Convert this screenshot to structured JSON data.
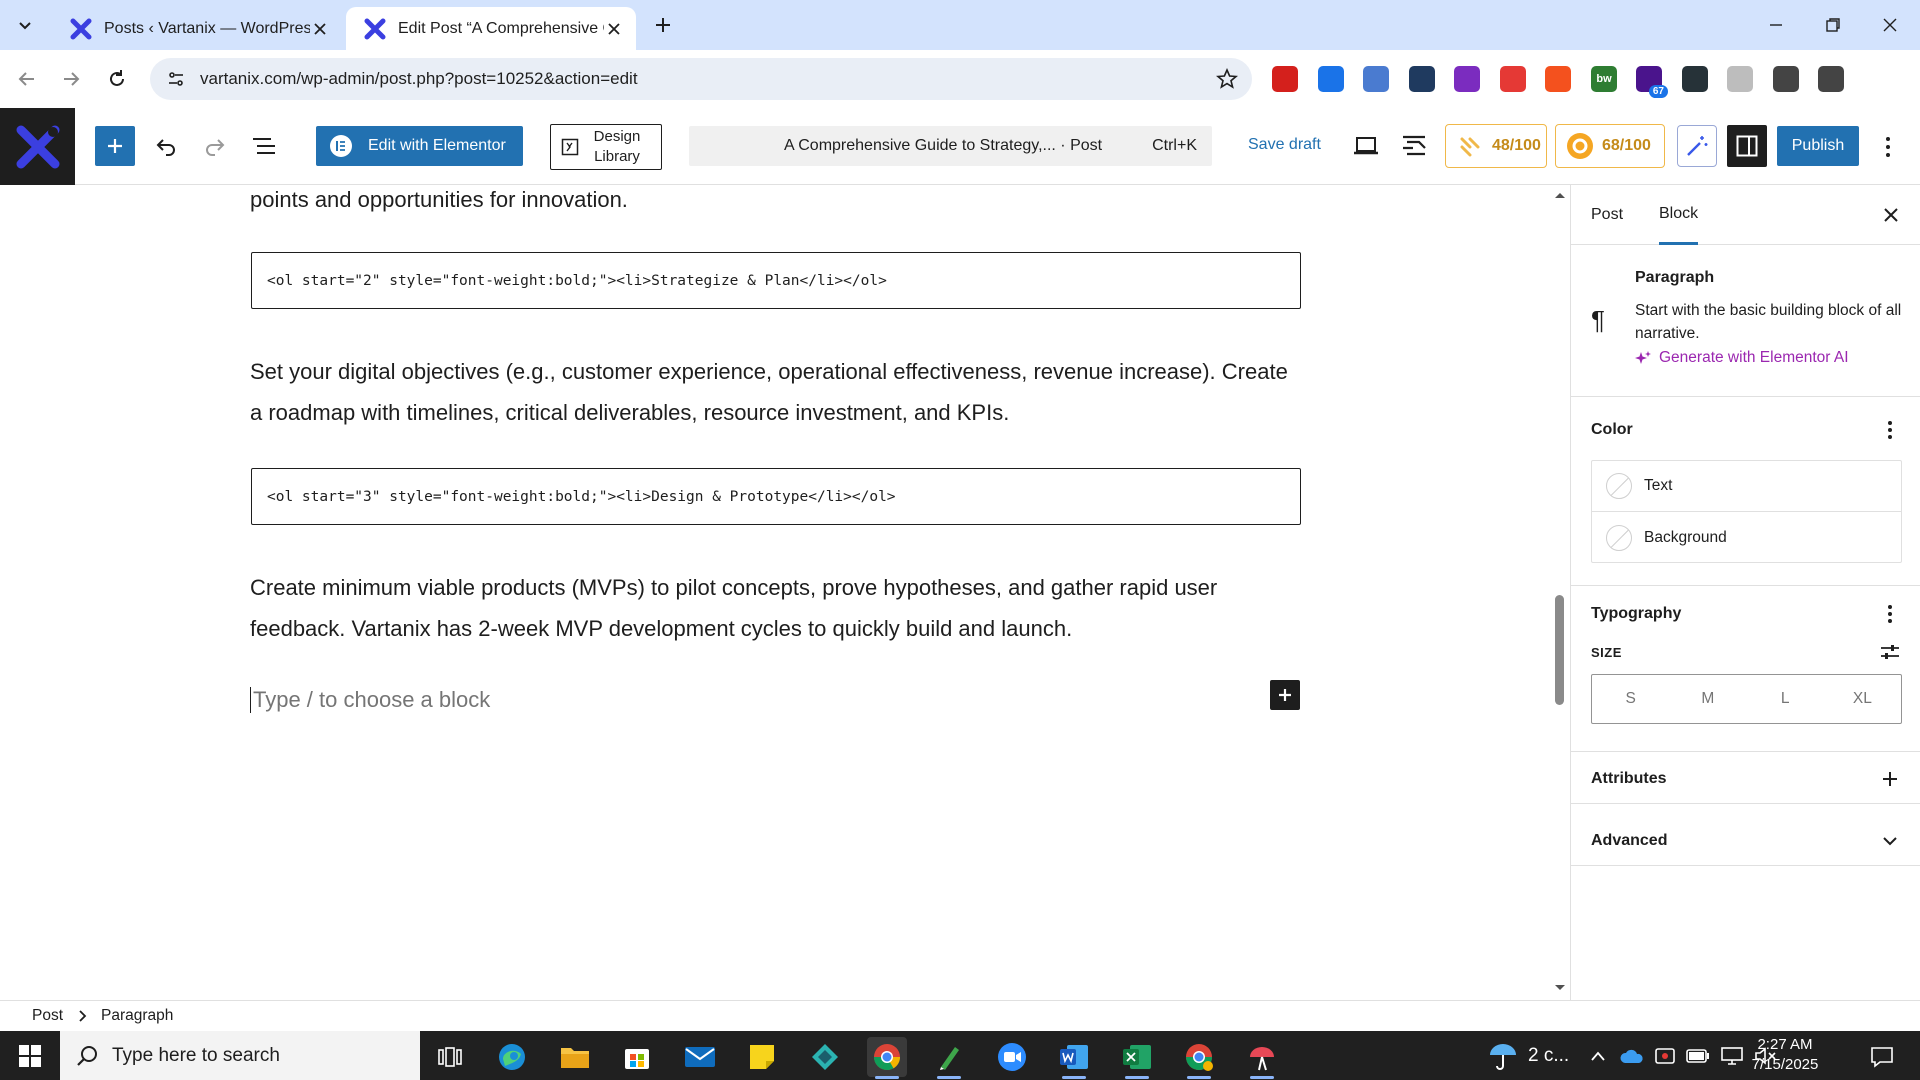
{
  "browser": {
    "tabs": [
      {
        "title": "Posts ‹ Vartanix — WordPress",
        "active": false
      },
      {
        "title": "Edit Post “A Comprehensive Gu",
        "active": true
      }
    ],
    "url": "vartanix.com/wp-admin/post.php?post=10252&action=edit",
    "extensions": [
      {
        "icon": "acrobat-icon",
        "color": "#d4201c"
      },
      {
        "icon": "shield-extension-icon",
        "color": "#1a73e8"
      },
      {
        "icon": "doc-extension-icon",
        "color": "#4a7bd0"
      },
      {
        "icon": "camera-extension-icon",
        "color": "#1f3a5f"
      },
      {
        "icon": "circle-extension-icon",
        "color": "#7b2cbf"
      },
      {
        "icon": "pokeball-extension-icon",
        "color": "#e53935"
      },
      {
        "icon": "yoast-extension-icon",
        "color": "#f4511e"
      },
      {
        "icon": "bw-extension-icon",
        "color": "#2e7d32",
        "label": "bw"
      },
      {
        "icon": "cap-extension-icon",
        "color": "#4a148c",
        "badge": "67"
      },
      {
        "icon": "react-extension-icon",
        "color": "#263238"
      },
      {
        "icon": "compass-extension-icon",
        "color": "#bdbdbd"
      },
      {
        "icon": "puzzle-extension-icon",
        "color": "#444"
      },
      {
        "icon": "profile-icon",
        "color": "#444"
      }
    ]
  },
  "wp_toolbar": {
    "elementor_label": "Edit with Elementor",
    "design_library_label": "Design Library",
    "command_title": "A Comprehensive Guide to Strategy,... · Post",
    "command_shortcut": "Ctrl+K",
    "save_draft": "Save draft",
    "score_one": "48/100",
    "score_two": "68/100",
    "publish": "Publish",
    "accent": "#2271b1"
  },
  "content": {
    "intro_tail": "points and opportunities for innovation.",
    "code_one": "<ol start=\"2\" style=\"font-weight:bold;\"><li>Strategize & Plan</li></ol>",
    "para_one_line1": "Set your digital objectives (e.g., customer experience, operational effectiveness, revenue increase). Create",
    "para_one_line2": "a roadmap with timelines, critical deliverables, resource investment, and KPIs.",
    "code_two": "<ol start=\"3\" style=\"font-weight:bold;\"><li>Design & Prototype</li></ol>",
    "para_two_line1": "Create minimum viable products (MVPs) to pilot concepts, prove hypotheses, and gather rapid user",
    "para_two_line2": "feedback. Vartanix has 2-week MVP development cycles to quickly build and launch.",
    "placeholder": "Type / to choose a block"
  },
  "sidebar": {
    "tab_post": "Post",
    "tab_block": "Block",
    "block_name": "Paragraph",
    "block_desc": "Start with the basic building block of all narrative.",
    "ai_link": "Generate with Elementor AI",
    "color_title": "Color",
    "color_text": "Text",
    "color_background": "Background",
    "typography_title": "Typography",
    "size_label": "SIZE",
    "sizes": [
      "S",
      "M",
      "L",
      "XL"
    ],
    "attributes_title": "Attributes",
    "advanced_title": "Advanced"
  },
  "breadcrumb": {
    "root": "Post",
    "current": "Paragraph"
  },
  "taskbar": {
    "search_placeholder": "Type here to search",
    "weather": "2 c...",
    "time": "2:27 AM",
    "date": "7/15/2025"
  }
}
